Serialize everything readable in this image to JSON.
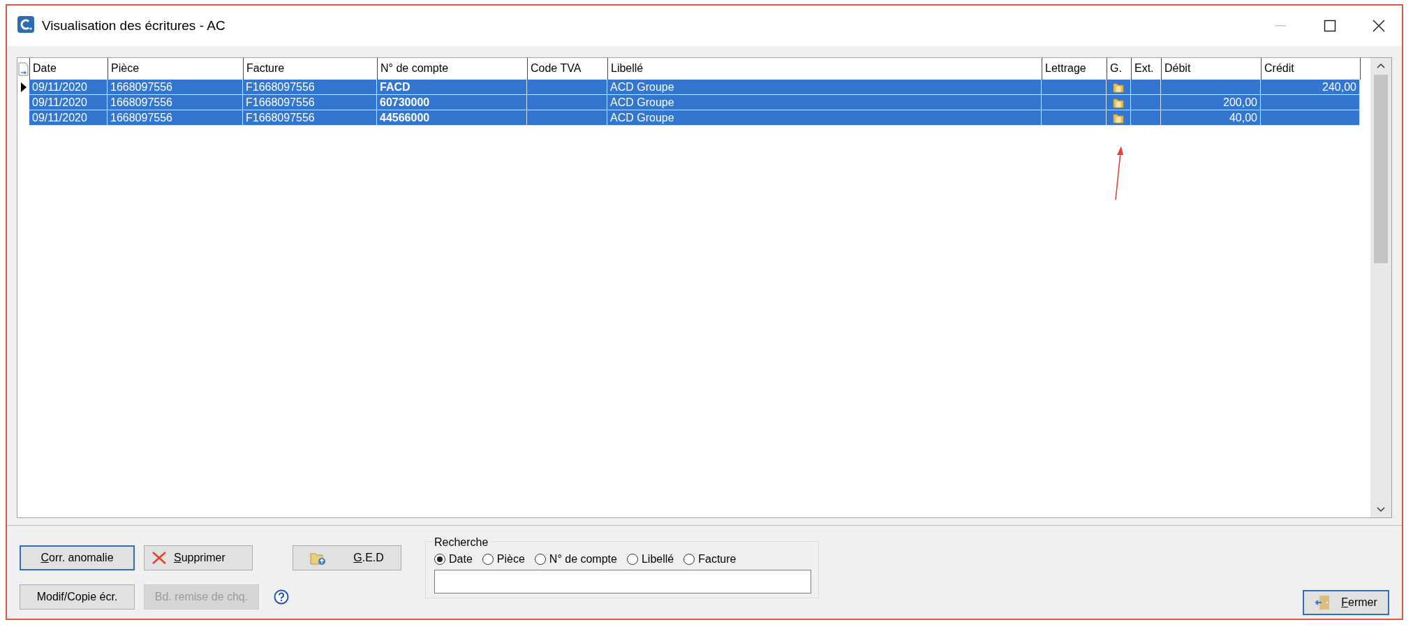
{
  "window": {
    "title": "Visualisation des écritures - AC"
  },
  "table": {
    "columns": [
      "Date",
      "Pièce",
      "Facture",
      "N° de compte",
      "Code TVA",
      "Libellé",
      "Lettrage",
      "G.",
      "Ext.",
      "Débit",
      "Crédit"
    ],
    "rows": [
      {
        "current": true,
        "selected": true,
        "date": "09/11/2020",
        "piece": "1668097556",
        "facture": "F1668097556",
        "compte": "FACD",
        "libelle": "ACD Groupe",
        "document": true,
        "credit": "240,00"
      },
      {
        "current": false,
        "selected": true,
        "date": "09/11/2020",
        "piece": "1668097556",
        "facture": "F1668097556",
        "compte": "60730000",
        "libelle": "ACD Groupe",
        "document": true,
        "debit": "200,00"
      },
      {
        "current": false,
        "selected": true,
        "date": "09/11/2020",
        "piece": "1668097556",
        "facture": "F1668097556",
        "compte": "44566000",
        "libelle": "ACD Groupe",
        "document": true,
        "debit": "40,00"
      }
    ]
  },
  "annotation": {
    "kind": "arrow"
  },
  "buttons": [
    {
      "kind": "plain",
      "label": "Corr. anomalie",
      "access_key": true,
      "focused": true,
      "disabled": false
    },
    {
      "kind": "delete",
      "label": "Supprimer",
      "access_key": true,
      "focused": false,
      "disabled": false
    },
    {
      "kind": "ged",
      "label": "G.E.D",
      "access_key": true,
      "focused": false,
      "disabled": false
    },
    {
      "kind": "plain",
      "label": "Modif/Copie écr.",
      "access_key": false,
      "focused": false,
      "disabled": false
    },
    {
      "kind": "plain",
      "label": "Bd. remise de chq.",
      "access_key": false,
      "focused": false,
      "disabled": true
    }
  ],
  "search": {
    "label": "Recherche",
    "options": [
      {
        "label": "Date",
        "selected": true
      },
      {
        "label": "Pièce",
        "selected": false
      },
      {
        "label": "N° de compte",
        "selected": false
      },
      {
        "label": "Libellé",
        "selected": false
      },
      {
        "label": "Facture",
        "selected": false
      }
    ]
  },
  "close_button": {
    "label": "Fermer",
    "access_key": true,
    "focused": true
  }
}
